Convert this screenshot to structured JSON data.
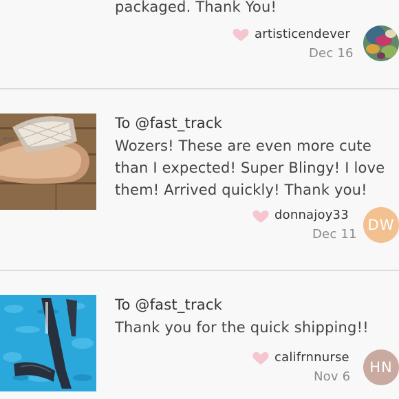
{
  "reviews": [
    {
      "to": "",
      "text": "packaged. Thank You!",
      "username": "artisticendever",
      "date": "Dec 16",
      "avatar": {
        "type": "image",
        "initials": ""
      }
    },
    {
      "to": "To @fast_track",
      "text": "Wozers! These are even more cute than I expected! Super Blingy! I love them! Arrived quickly! Thank you!",
      "username": "donnajoy33",
      "date": "Dec 11",
      "avatar": {
        "type": "initials",
        "initials": "DW",
        "color": "#f3c08f"
      }
    },
    {
      "to": "To @fast_track",
      "text": "Thank you for the quick shipping!!",
      "username": "califrnnurse",
      "date": "Nov 6",
      "avatar": {
        "type": "initials",
        "initials": "HN",
        "color": "#c8aaa0"
      }
    }
  ],
  "icons": {
    "like": "heart-icon"
  },
  "colors": {
    "heart": "#f6c5cf",
    "divider": "#dcdcdc",
    "background": "#f8f8f8"
  }
}
